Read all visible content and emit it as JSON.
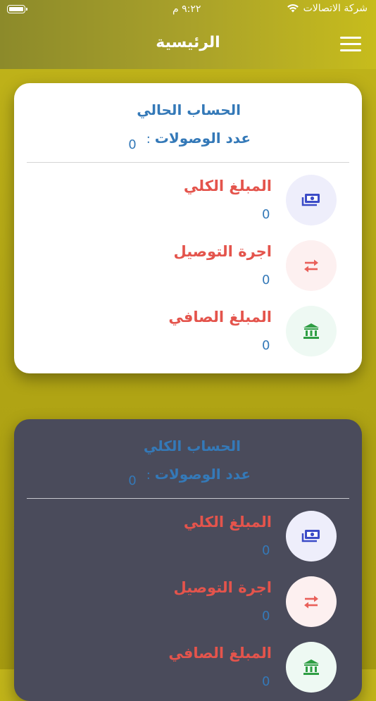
{
  "status": {
    "carrier": "شركة الاتصالات",
    "time": "٩:٢٢ م"
  },
  "header": {
    "title": "الرئيسية"
  },
  "cards": [
    {
      "title": "الحساب الحالي",
      "count_label": "عدد الوصولات",
      "count_sep": ":",
      "count_value": "0",
      "rows": [
        {
          "label": "المبلغ الكلي",
          "value": "0",
          "icon": "money-icon"
        },
        {
          "label": "اجرة التوصيل",
          "value": "0",
          "icon": "exchange-icon"
        },
        {
          "label": "المبلغ الصافي",
          "value": "0",
          "icon": "bank-icon"
        }
      ]
    },
    {
      "title": "الحساب الكلي",
      "count_label": "عدد الوصولات",
      "count_sep": ":",
      "count_value": "0",
      "rows": [
        {
          "label": "المبلغ الكلي",
          "value": "0",
          "icon": "money-icon"
        },
        {
          "label": "اجرة التوصيل",
          "value": "0",
          "icon": "exchange-icon"
        },
        {
          "label": "المبلغ الصافي",
          "value": "0",
          "icon": "bank-icon"
        }
      ]
    }
  ],
  "colors": {
    "accent_blue": "#3479b8",
    "label_red": "#e4544c",
    "money_blue": "#3b4bc7",
    "exchange_red": "#e9605a",
    "bank_green": "#2f9e44"
  }
}
